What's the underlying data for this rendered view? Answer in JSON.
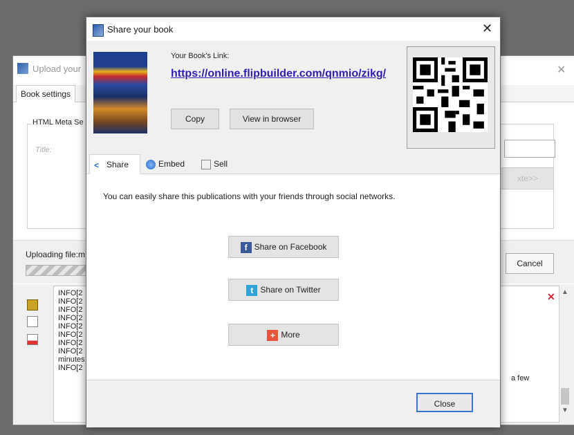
{
  "background_window": {
    "title": "Upload your",
    "tab_label": "Book settings",
    "group_label": "HTML Meta Se",
    "title_field_label": "Title:",
    "next_button_label": "xte>>",
    "uploading_label": "Uploading file:m",
    "cancel_label": "Cancel",
    "log_lines": [
      "INFO[2",
      "INFO[2",
      "INFO[2",
      "INFO[2",
      "INFO[2",
      "INFO[2",
      "INFO[2",
      "INFO[2",
      "minutes",
      "INFO[2"
    ],
    "log_trailing_text": "a few"
  },
  "dialog": {
    "title": "Share your book",
    "close_glyph": "✕",
    "link_label": "Your Book's Link:",
    "book_link": "https://online.flipbuilder.com/qnmio/zikg/",
    "copy_label": "Copy",
    "view_label": "View in browser",
    "tabs": [
      {
        "label": "Share",
        "icon": "share-icon"
      },
      {
        "label": "Embed",
        "icon": "globe-icon"
      },
      {
        "label": "Sell",
        "icon": "sell-icon"
      }
    ],
    "share_description": "You can easily share this publications with your friends through social networks.",
    "share_buttons": [
      {
        "label": "Share on Facebook",
        "icon": "facebook-icon",
        "color": "#3b5998",
        "glyph": "f"
      },
      {
        "label": "Share on Twitter",
        "icon": "twitter-icon",
        "color": "#2fa4d9",
        "glyph": "t"
      },
      {
        "label": "More",
        "icon": "more-icon",
        "color": "#e8553e",
        "glyph": "+"
      }
    ],
    "close_button_label": "Close"
  }
}
